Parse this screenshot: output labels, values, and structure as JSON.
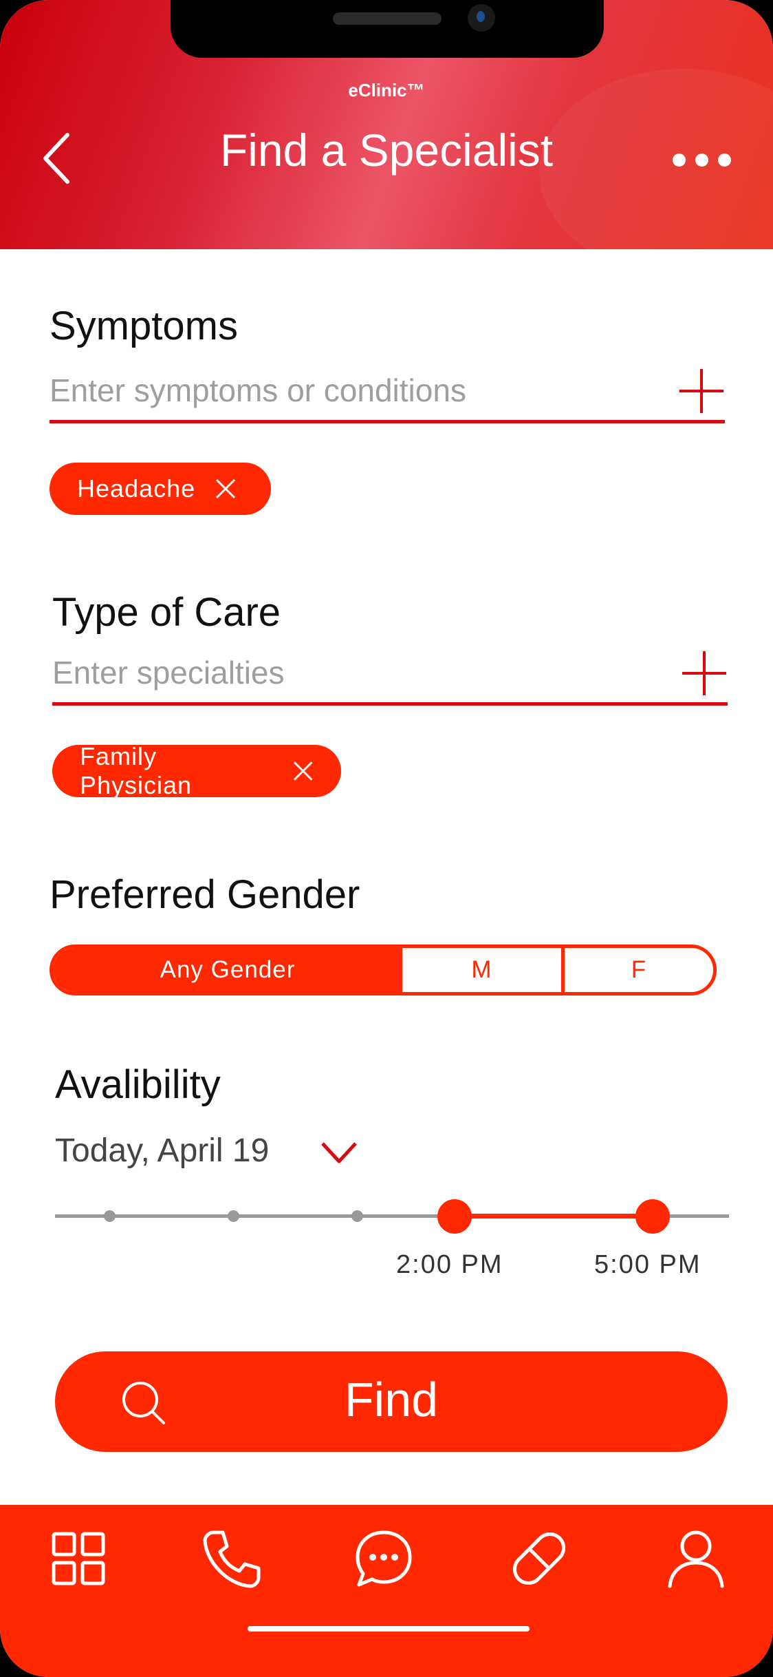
{
  "app": {
    "brand": "eClinic™",
    "title": "Find a Specialist"
  },
  "symptoms": {
    "title": "Symptoms",
    "placeholder": "Enter symptoms or conditions",
    "chips": [
      "Headache"
    ]
  },
  "care": {
    "title": "Type of Care",
    "placeholder": "Enter specialties",
    "chips": [
      "Family Physician"
    ]
  },
  "gender": {
    "title": "Preferred Gender",
    "options": [
      "Any Gender",
      "M",
      "F"
    ],
    "selected": "Any Gender"
  },
  "availability": {
    "title": "Avalibility",
    "date": "Today, April 19",
    "start_label": "2:00 PM",
    "end_label": "5:00 PM"
  },
  "find": {
    "label": "Find"
  },
  "nav": {
    "items": [
      "grid-icon",
      "phone-icon",
      "chat-icon",
      "pill-icon",
      "profile-icon"
    ]
  },
  "colors": {
    "accent": "#ff2800",
    "header_dark": "#c8000a",
    "underline": "#d60a12"
  }
}
